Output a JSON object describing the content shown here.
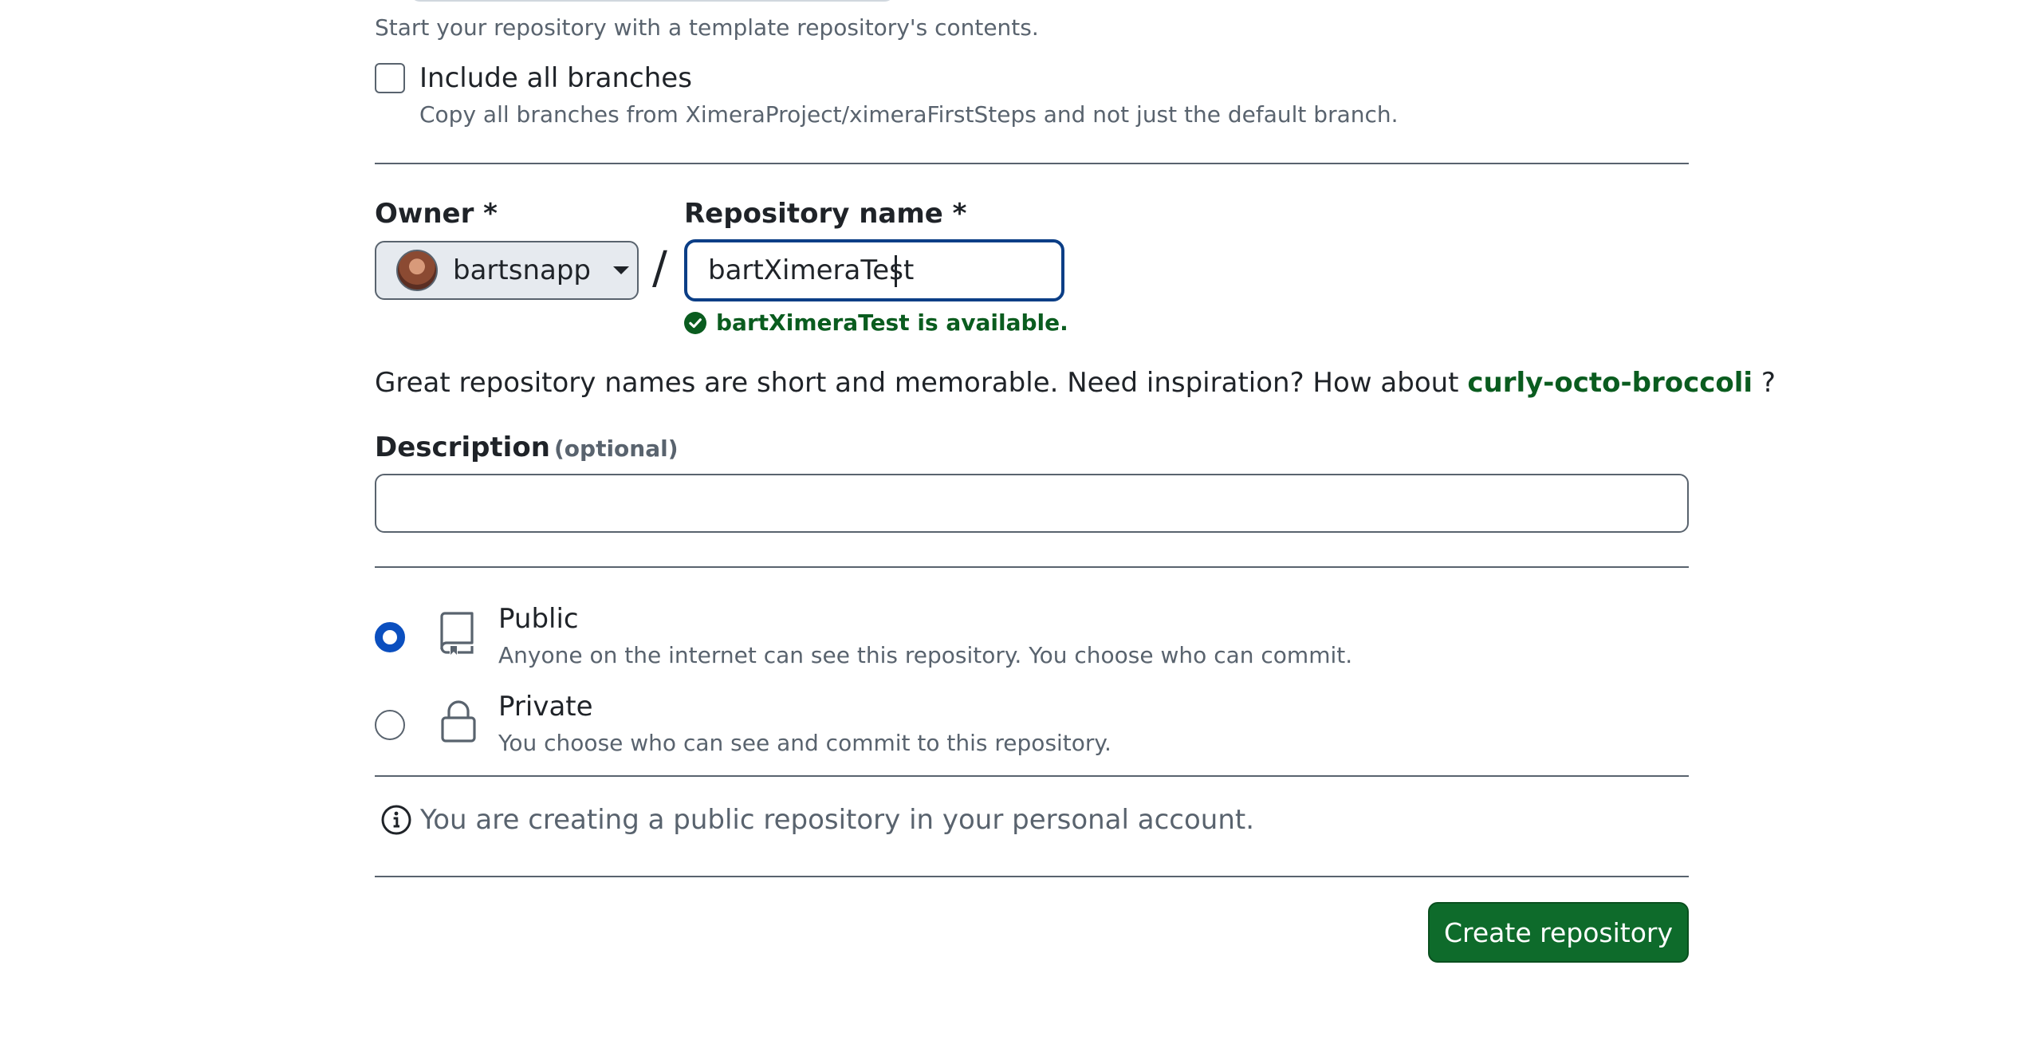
{
  "template": {
    "hint": "Start your repository with a template repository's contents.",
    "include_all_branches_label": "Include all branches",
    "include_all_branches_desc": "Copy all branches from XimeraProject/ximeraFirstSteps and not just the default branch.",
    "include_all_branches_checked": false
  },
  "owner": {
    "label": "Owner *",
    "selected": "bartsnapp"
  },
  "separator": "/",
  "repo_name": {
    "label": "Repository name *",
    "value": "bartXimeraTest",
    "availability": "bartXimeraTest is available."
  },
  "inspiration": {
    "prefix": "Great repository names are short and memorable. Need inspiration? How about",
    "suggestion": "curly-octo-broccoli",
    "suffix": "?"
  },
  "description": {
    "label": "Description",
    "optional": "(optional)",
    "value": ""
  },
  "visibility": {
    "selected": "Public",
    "options": [
      {
        "title": "Public",
        "desc": "Anyone on the internet can see this repository. You choose who can commit.",
        "icon": "repo-icon"
      },
      {
        "title": "Private",
        "desc": "You choose who can see and commit to this repository.",
        "icon": "lock-icon"
      }
    ]
  },
  "info_message": "You are creating a public repository in your personal account.",
  "create_button_label": "Create repository",
  "colors": {
    "success_green": "#0a5c1f",
    "button_green": "#0e6b2b",
    "focus_blue": "#0b3e86",
    "radio_blue": "#0b4fbf"
  }
}
